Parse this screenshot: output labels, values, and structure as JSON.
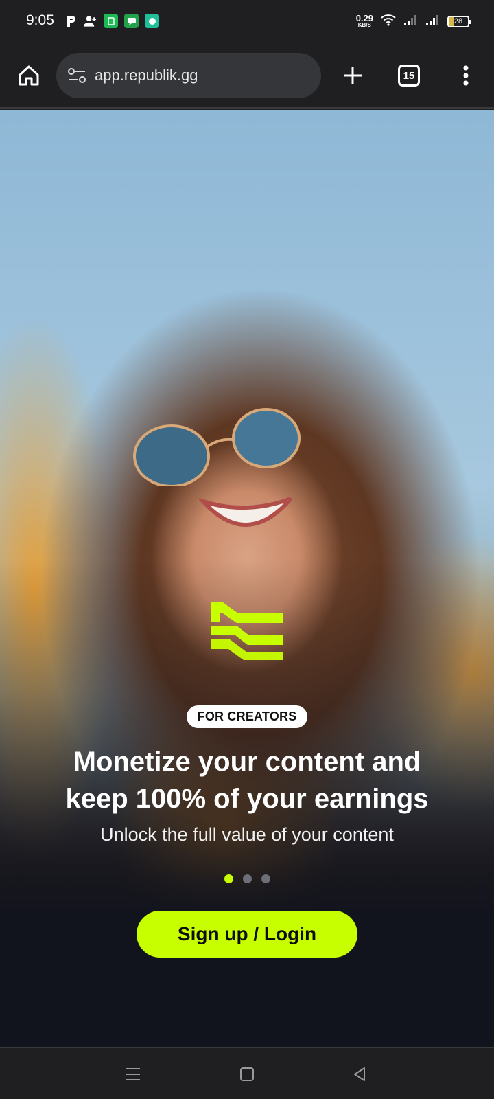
{
  "status_bar": {
    "time": "9:05",
    "net_speed_value": "0.29",
    "net_speed_unit": "KB/S",
    "battery": "28"
  },
  "browser": {
    "url": "app.republik.gg",
    "tab_count": "15"
  },
  "hero": {
    "badge": "FOR CREATORS",
    "title": "Monetize your content and keep 100% of your earnings",
    "subtitle": "Unlock the full value of your content",
    "carousel_total": 3,
    "carousel_active": 1,
    "cta_label": "Sign up / Login"
  },
  "colors": {
    "accent": "#c8ff00",
    "background_dark": "#12141d",
    "chrome": "#1f1f21"
  },
  "icons": {
    "status": [
      "parking-icon",
      "add-person-icon",
      "green-app-icon",
      "messages-icon",
      "chat-icon",
      "wifi-icon",
      "signal-icon",
      "signal-icon",
      "battery-icon"
    ],
    "toolbar": [
      "home-icon",
      "site-settings-icon",
      "plus-icon",
      "tabs-icon",
      "more-vert-icon"
    ],
    "nav": [
      "recents-icon",
      "home-square-icon",
      "back-icon"
    ]
  }
}
